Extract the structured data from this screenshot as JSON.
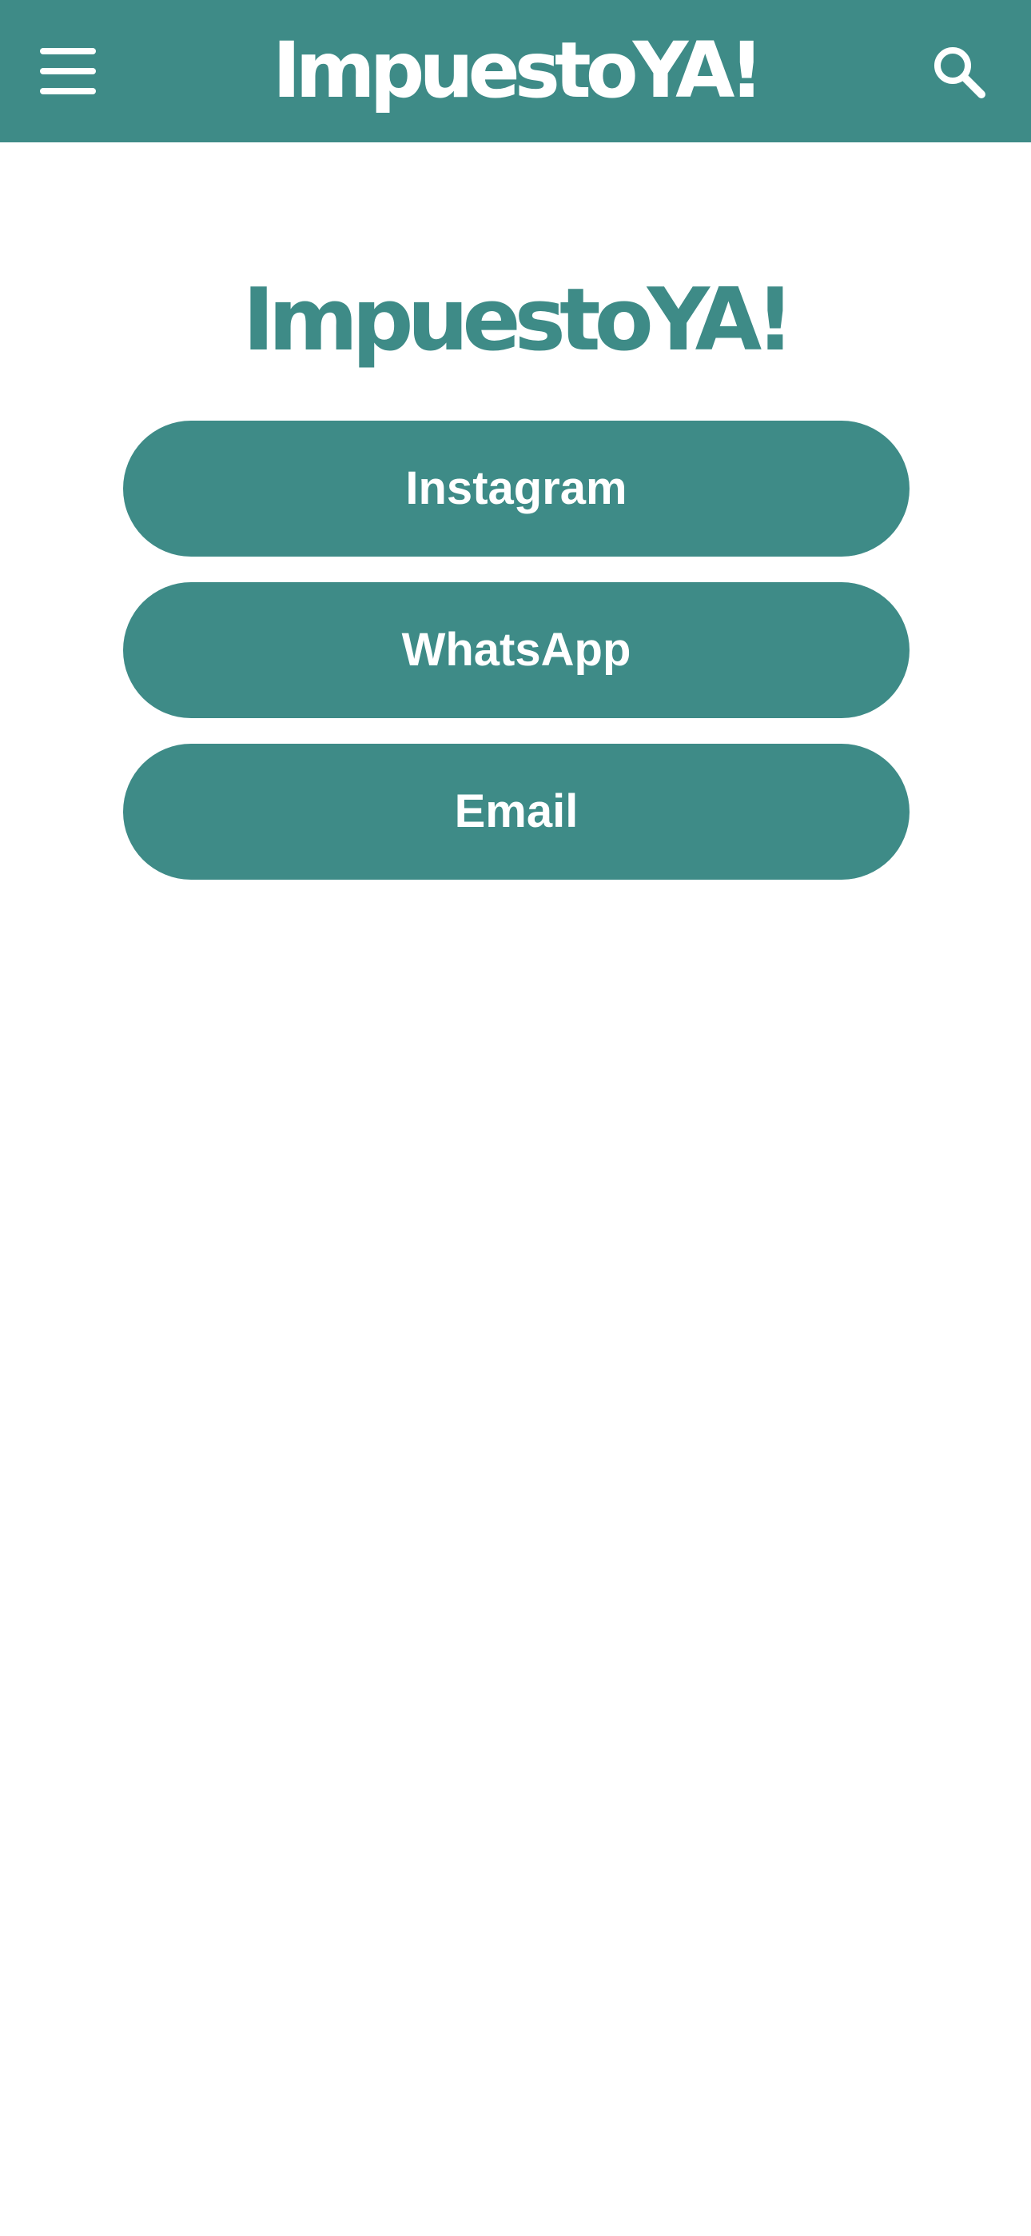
{
  "header": {
    "logo_text": "ImpuestoYA!",
    "menu_icon": "hamburger-menu-icon",
    "search_icon": "search-icon",
    "background_color": "#3e8b87"
  },
  "main": {
    "brand_title": "ImpuestoYA!",
    "brand_color": "#3e8b87",
    "buttons": [
      {
        "label": "Instagram"
      },
      {
        "label": "WhatsApp"
      },
      {
        "label": "Email"
      }
    ]
  }
}
